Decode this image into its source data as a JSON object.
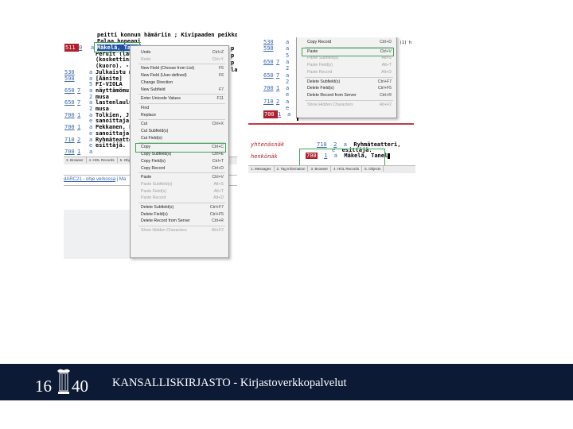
{
  "left_window": {
    "header_lines": [
      "peitti konnun hämäriin ; Kivipaaden peikko ; Durinin",
      "Palaa hopeani"
    ],
    "rows": [
      {
        "tag": "511",
        "ind": "0",
        "sub": "a",
        "text": "Mäkelä, Tanel"
      },
      {
        "tag": "",
        "ind": "",
        "sub": "",
        "text": "Peruit (laulu)"
      },
      {
        "tag": "",
        "ind": "",
        "sub": "",
        "text": "(koskettinsoi"
      },
      {
        "tag": "",
        "ind": "",
        "sub": "",
        "text": "(kuoro). - Li"
      },
      {
        "tag": "530",
        "ind": "",
        "sub": "a",
        "text": "Julkaistu my"
      },
      {
        "tag": "598",
        "ind": "",
        "sub": "a",
        "text": "[Äänite]"
      },
      {
        "tag": "",
        "ind": "",
        "sub": "5",
        "text": "FI-VIOLA"
      },
      {
        "tag": "650",
        "ind": "7",
        "sub": "a",
        "text": "näyttämömu"
      },
      {
        "tag": "",
        "ind": "",
        "sub": "2",
        "text": "musa"
      },
      {
        "tag": "650",
        "ind": "7",
        "sub": "a",
        "text": "lastenlaulut"
      },
      {
        "tag": "",
        "ind": "",
        "sub": "2",
        "text": "musa"
      },
      {
        "tag": "700",
        "ind": "1",
        "sub": "a",
        "text": "Tolkien, J. R."
      },
      {
        "tag": "",
        "ind": "",
        "sub": "e",
        "text": "sanoittaja."
      },
      {
        "tag": "700",
        "ind": "1",
        "sub": "a",
        "text": "Pekkanen, Pa"
      },
      {
        "tag": "",
        "ind": "",
        "sub": "e",
        "text": "sanoittaja."
      },
      {
        "tag": "710",
        "ind": "2",
        "sub": "a",
        "text": "Ryhmäteatte"
      },
      {
        "tag": "",
        "ind": "",
        "sub": "e",
        "text": "esittäjä."
      },
      {
        "tag": "700",
        "ind": "1",
        "sub": "a",
        "text": ""
      }
    ],
    "right_fragments": [
      "p",
      "p",
      "p",
      "la"
    ],
    "tabs": [
      "3. Browser",
      "4. HOL Records",
      "5. Object"
    ],
    "link_text": "dARC21 - ohje verkossa",
    "link_sep": "| Ma"
  },
  "context_menu": {
    "items": [
      {
        "label": "Undo",
        "shortcut": "Ctrl+Z",
        "disabled": false
      },
      {
        "label": "Redo",
        "shortcut": "Ctrl+Y",
        "disabled": true
      },
      {
        "sep": true
      },
      {
        "label": "New Field (Choose from List)",
        "shortcut": "F5",
        "disabled": false
      },
      {
        "label": "New Field (User-defined)",
        "shortcut": "F6",
        "disabled": false
      },
      {
        "label": "Change Direction",
        "shortcut": "",
        "disabled": false
      },
      {
        "label": "New Subfield",
        "shortcut": "F7",
        "disabled": false
      },
      {
        "sep": true
      },
      {
        "label": "Enter Unicode Values",
        "shortcut": "F11",
        "disabled": false
      },
      {
        "sep": true
      },
      {
        "label": "Find",
        "shortcut": "",
        "disabled": false
      },
      {
        "label": "Replace",
        "shortcut": "",
        "disabled": false
      },
      {
        "sep": true
      },
      {
        "label": "Cut",
        "shortcut": "Ctrl+X",
        "disabled": false
      },
      {
        "label": "Cut Subfield(s)",
        "shortcut": "",
        "disabled": false
      },
      {
        "label": "Cut Field(s)",
        "shortcut": "",
        "disabled": false
      },
      {
        "sep": true
      },
      {
        "label": "Copy",
        "shortcut": "Ctrl+C",
        "disabled": false,
        "highlight": true
      },
      {
        "label": "Copy Subfield(s)",
        "shortcut": "Ctrl+E",
        "disabled": false
      },
      {
        "label": "Copy Field(s)",
        "shortcut": "Ctrl+T",
        "disabled": false
      },
      {
        "label": "Copy Record",
        "shortcut": "Ctrl+D",
        "disabled": false
      },
      {
        "sep": true
      },
      {
        "label": "Paste",
        "shortcut": "Ctrl+V",
        "disabled": false
      },
      {
        "label": "Paste Subfield(s)",
        "shortcut": "Alt+S",
        "disabled": true
      },
      {
        "label": "Paste Field(s)",
        "shortcut": "Alt+T",
        "disabled": true
      },
      {
        "label": "Paste Record",
        "shortcut": "Alt+D",
        "disabled": true
      },
      {
        "sep": true
      },
      {
        "label": "Delete Subfield(s)",
        "shortcut": "Ctrl+F7",
        "disabled": false
      },
      {
        "label": "Delete Field(s)",
        "shortcut": "Ctrl+F5",
        "disabled": false
      },
      {
        "label": "Delete Record from Server",
        "shortcut": "Ctrl+R",
        "disabled": false
      },
      {
        "sep": true
      },
      {
        "label": "Show Hidden Characters",
        "shortcut": "Alt+F2",
        "disabled": true
      }
    ]
  },
  "right_window": {
    "rows": [
      {
        "tag": "530",
        "ind": "",
        "sub": "a"
      },
      {
        "tag": "598",
        "ind": "",
        "sub": "a"
      },
      {
        "tag": "",
        "ind": "",
        "sub": "5"
      },
      {
        "tag": "650",
        "ind": "7",
        "sub": "a"
      },
      {
        "tag": "",
        "ind": "",
        "sub": "2"
      },
      {
        "tag": "650",
        "ind": "7",
        "sub": "a"
      },
      {
        "tag": "",
        "ind": "",
        "sub": "2"
      },
      {
        "tag": "700",
        "ind": "1",
        "sub": "a"
      },
      {
        "tag": "",
        "ind": "",
        "sub": "e"
      },
      {
        "tag": "710",
        "ind": "2",
        "sub": "a"
      },
      {
        "tag": "",
        "ind": "",
        "sub": "e"
      },
      {
        "tag": "700",
        "ind": "1",
        "sub": "a"
      }
    ],
    "menu": {
      "items": [
        {
          "label": "Copy Record",
          "shortcut": "Ctrl+D",
          "disabled": false
        },
        {
          "sep": true
        },
        {
          "label": "Paste",
          "shortcut": "Ctrl+V",
          "disabled": false,
          "highlight": true
        },
        {
          "label": "Paste Subfield(s)",
          "shortcut": "Alt+S",
          "disabled": true
        },
        {
          "label": "Paste Field(s)",
          "shortcut": "Alt+T",
          "disabled": true
        },
        {
          "label": "Paste Record",
          "shortcut": "Alt+D",
          "disabled": true
        },
        {
          "sep": true
        },
        {
          "label": "Delete Subfield(s)",
          "shortcut": "Ctrl+F7",
          "disabled": false
        },
        {
          "label": "Delete Field(s)",
          "shortcut": "Ctrl+F5",
          "disabled": false
        },
        {
          "label": "Delete Record from Server",
          "shortcut": "Ctrl+R",
          "disabled": false
        },
        {
          "sep": true
        },
        {
          "label": "Show Hidden Characters",
          "shortcut": "Alt+F2",
          "disabled": true
        }
      ]
    },
    "corner_text": "(1) h"
  },
  "bottom_right": {
    "label1": "yhtenäsnäk",
    "label2": "henkönäk",
    "row1": {
      "tag": "710",
      "ind": "2",
      "sub": "a",
      "text": "Ryhmäteatteri,"
    },
    "row1b": {
      "sub": "e",
      "text": "esittäjä."
    },
    "row2": {
      "tag": "700",
      "ind": "1",
      "sub": "a",
      "text": "Mäkelä, Tanel"
    },
    "tabs": [
      "1. Messages",
      "2. Tag Information",
      "3. Browser",
      "4. HOL Records",
      "5. Objects"
    ]
  },
  "footer": {
    "logo_left": "16",
    "logo_right": "40",
    "title": "KANSALLISKIRJASTO - Kirjastoverkkopalvelut"
  },
  "colors": {
    "footer_bg": "#0c1a35",
    "highlight_green": "#3aa757",
    "tag_red": "#b01e2a",
    "tag_blue": "#3a66b0"
  }
}
